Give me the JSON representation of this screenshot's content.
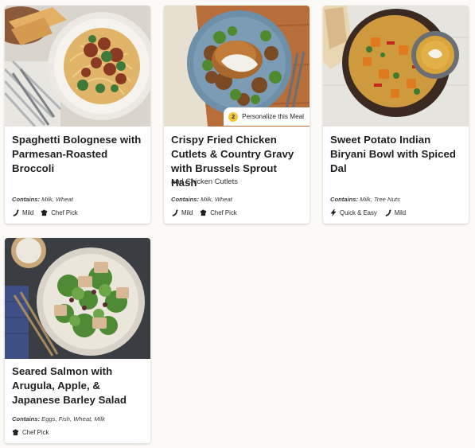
{
  "meals": [
    {
      "title": "Spaghetti Bolognese with Parmesan-Roasted Broccoli",
      "subtitle": "",
      "contains_label": "Contains:",
      "contains": "Milk, Wheat",
      "tags": [
        {
          "icon": "chili-pepper-icon",
          "label": "Mild"
        },
        {
          "icon": "chef-hat-icon",
          "label": "Chef Pick"
        }
      ]
    },
    {
      "title": "Crispy Fried Chicken Cutlets & Country Gravy with Brussels Sprout Hash",
      "subtitle": "and Chicken Cutlets",
      "contains_label": "Contains:",
      "contains": "Milk, Wheat",
      "personalize": {
        "count": "2",
        "label": "Personalize this Meal"
      },
      "tags": [
        {
          "icon": "chili-pepper-icon",
          "label": "Mild"
        },
        {
          "icon": "chef-hat-icon",
          "label": "Chef Pick"
        }
      ]
    },
    {
      "title": "Sweet Potato Indian Biryani Bowl with Spiced Dal",
      "subtitle": "",
      "contains_label": "Contains:",
      "contains": "Milk, Tree Nuts",
      "tags": [
        {
          "icon": "lightning-bolt-icon",
          "label": "Quick & Easy"
        },
        {
          "icon": "chili-pepper-icon",
          "label": "Mild"
        }
      ]
    },
    {
      "title": "Seared Salmon with Arugula, Apple, & Japanese Barley Salad",
      "subtitle": "",
      "contains_label": "Contains:",
      "contains": "Eggs, Fish, Wheat, Milk",
      "tags": [
        {
          "icon": "chef-hat-icon",
          "label": "Chef Pick"
        }
      ]
    }
  ]
}
